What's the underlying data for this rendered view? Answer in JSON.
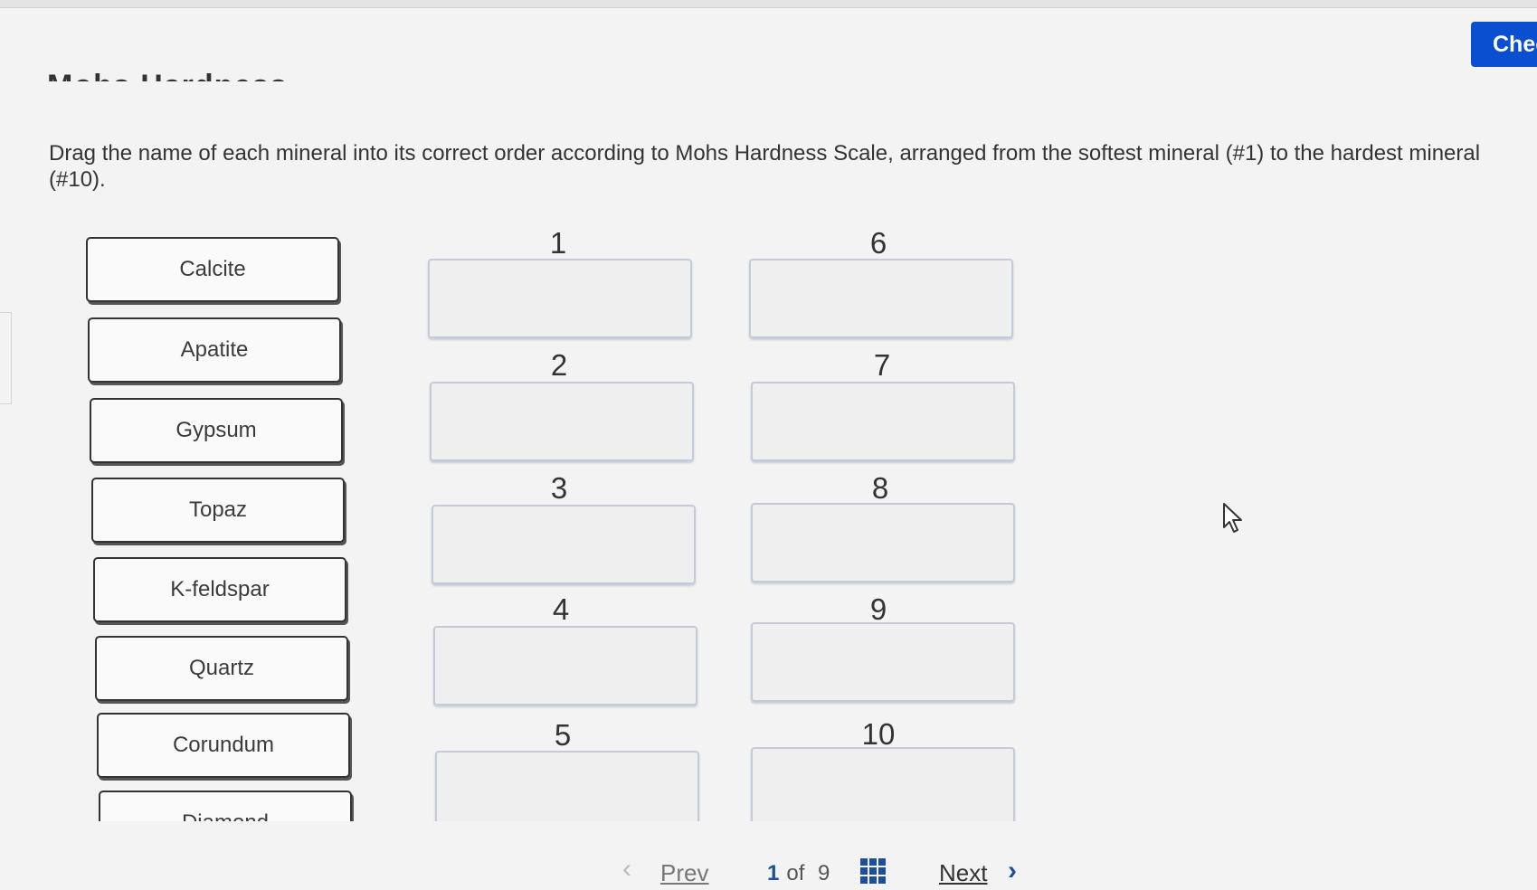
{
  "header": {
    "title": "Mohs Hardness Scale",
    "check_label": "Check"
  },
  "instructions": "Drag the name of each mineral into its correct order according to Mohs Hardness Scale, arranged from the softest mineral (#1) to the hardest mineral (#10).",
  "tiles": [
    "Calcite",
    "Apatite",
    "Gypsum",
    "Topaz",
    "K-feldspar",
    "Quartz",
    "Corundum",
    "Diamond"
  ],
  "slots": [
    "1",
    "2",
    "3",
    "4",
    "5",
    "6",
    "7",
    "8",
    "9",
    "10"
  ],
  "pagination": {
    "prev_label": "Prev",
    "current": "1",
    "of_label": "of",
    "total": "9",
    "next_label": "Next"
  },
  "icons": {
    "prev": "chevron-left-icon",
    "next": "chevron-right-icon",
    "grid": "grid-icon",
    "cursor": "mouse-pointer-icon"
  },
  "colors": {
    "accent": "#0a4fcf",
    "nav": "#1d4f9c"
  }
}
